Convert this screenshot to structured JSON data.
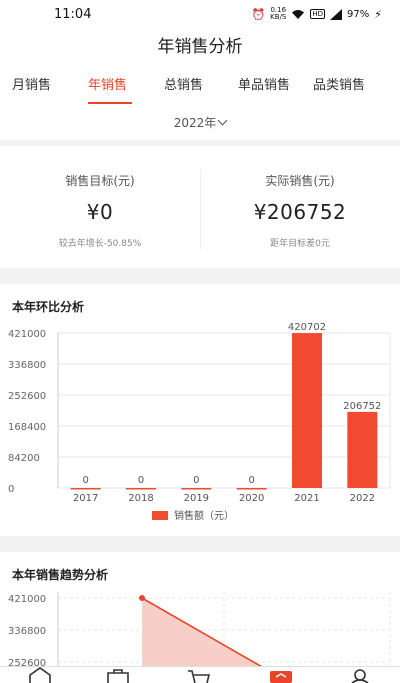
{
  "status": {
    "time": "11:04",
    "speed_value": "0.16",
    "speed_unit": "KB/S",
    "hd": "HD",
    "battery": "97%"
  },
  "header": {
    "title": "年销售分析"
  },
  "tabs": [
    {
      "label": "月销售"
    },
    {
      "label": "年销售"
    },
    {
      "label": "总销售"
    },
    {
      "label": "单品销售"
    },
    {
      "label": "品类销售"
    }
  ],
  "year_selector": {
    "value": "2022年"
  },
  "stats": {
    "target": {
      "label": "销售目标(元)",
      "value": "¥0",
      "sub": "较去年增长-50.85%"
    },
    "actual": {
      "label": "实际销售(元)",
      "value": "¥206752",
      "sub": "距年目标差0元"
    }
  },
  "bar_section": {
    "title": "本年环比分析"
  },
  "trend_section": {
    "title": "本年销售趋势分析"
  },
  "colors": {
    "accent": "#e8452a",
    "bar": "#f04a30",
    "area": "#f7c6c0"
  },
  "chart_data": [
    {
      "type": "bar",
      "categories": [
        "2017",
        "2018",
        "2019",
        "2020",
        "2021",
        "2022"
      ],
      "values": [
        0,
        0,
        0,
        0,
        420702,
        206752
      ],
      "yticks": [
        "0",
        "84200",
        "168400",
        "252600",
        "336800",
        "421000"
      ],
      "ylim": [
        0,
        421000
      ],
      "legend": "销售额（元）",
      "legend_position": "bottom",
      "grid": true
    },
    {
      "type": "area",
      "yticks": [
        "252600",
        "336800",
        "421000"
      ],
      "partial": true,
      "grid": true
    }
  ]
}
